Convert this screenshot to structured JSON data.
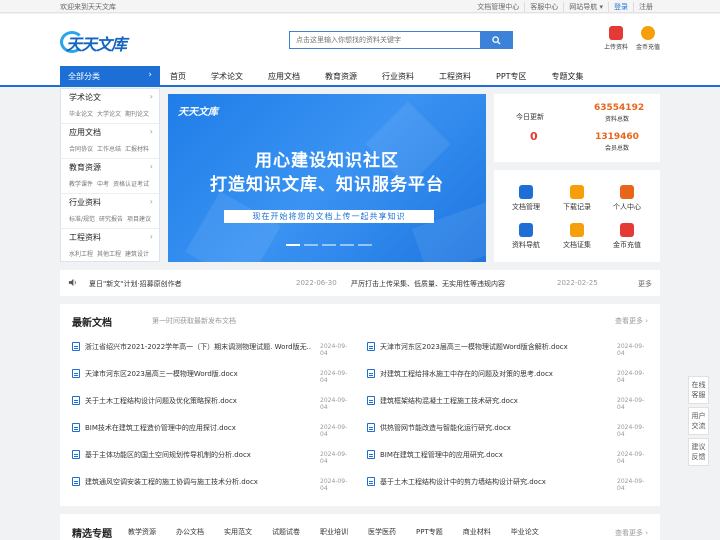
{
  "topbar": {
    "welcome": "欢迎来到天天文库",
    "links": [
      "文档管理中心",
      "客服中心",
      "网站导航 ▾",
      "登录",
      "注册"
    ]
  },
  "logo": {
    "text": "天天文库"
  },
  "search": {
    "placeholder": "点击这里输入你想找的资料关键字"
  },
  "header_icons": [
    {
      "label": "上传资料",
      "icon": "upload-icon",
      "color": "#e53935"
    },
    {
      "label": "金币充值",
      "icon": "coin-icon",
      "color": "#f59f0b"
    }
  ],
  "nav": {
    "all_label": "全部分类",
    "items": [
      "首页",
      "学术论文",
      "应用文档",
      "教育资源",
      "行业资料",
      "工程资料",
      "PPT专区",
      "专题文集"
    ]
  },
  "categories": [
    {
      "title": "学术论文",
      "subs": [
        "毕业论文",
        "大学论文",
        "期刊论文"
      ]
    },
    {
      "title": "应用文档",
      "subs": [
        "合同协议",
        "工作总结",
        "汇报材料"
      ]
    },
    {
      "title": "教育资源",
      "subs": [
        "教学课件",
        "中考",
        "资格认证考试"
      ]
    },
    {
      "title": "行业资料",
      "subs": [
        "标准/规范",
        "研究报告",
        "项目建议"
      ]
    },
    {
      "title": "工程资料",
      "subs": [
        "水利工程",
        "其他工程",
        "建筑设计"
      ]
    }
  ],
  "banner": {
    "brand": "天天文库",
    "line1": "用心建设知识社区",
    "line2": "打造知识文库、知识服务平台",
    "pill": "现在开始将您的文档上传一起共享知识"
  },
  "stats": {
    "today_label": "今日更新",
    "today_value": "0",
    "total_docs_value": "63554192",
    "total_docs_label": "资料总数",
    "members_value": "1319460",
    "members_label": "会员总数"
  },
  "quick_links": [
    {
      "label": "文档管理",
      "icon": "doc-manage-icon",
      "color": "#1d6fd6"
    },
    {
      "label": "下载记录",
      "icon": "download-icon",
      "color": "#f59f0b"
    },
    {
      "label": "个人中心",
      "icon": "user-icon",
      "color": "#e8651c"
    },
    {
      "label": "资料导航",
      "icon": "nav-icon",
      "color": "#1d6fd6"
    },
    {
      "label": "文档证集",
      "icon": "collect-icon",
      "color": "#f59f0b"
    },
    {
      "label": "金币充值",
      "icon": "coin-icon",
      "color": "#e53935"
    }
  ],
  "notice": {
    "item1": "夏日\"新文\"计划·招募原创作者",
    "date1": "2022-06-30",
    "item2": "严厉打击上传采集、低质量、无实用性等违规内容",
    "date2": "2022-02-25",
    "more": "更多"
  },
  "newest": {
    "title": "最新文档",
    "subtitle": "第一时间获取最新发布文档",
    "more": "查看更多 ›",
    "docs": [
      {
        "name": "浙江省绍兴市2021-2022学年高一（下）期末调测物理试题. Word版无...",
        "date": "2024-09-04"
      },
      {
        "name": "天津市河东区2023届高三一模物理试题Word版含解析.docx",
        "date": "2024-09-04"
      },
      {
        "name": "天津市河东区2023届高三一模物理Word版.docx",
        "date": "2024-09-04"
      },
      {
        "name": "对建筑工程给排水施工中存在的问题及对策的思考.docx",
        "date": "2024-09-04"
      },
      {
        "name": "关于土木工程结构设计问题及优化策略探析.docx",
        "date": "2024-09-04"
      },
      {
        "name": "建筑框架结构混凝土工程施工技术研究.docx",
        "date": "2024-09-04"
      },
      {
        "name": "BIM技术在建筑工程造价管理中的应用探讨.docx",
        "date": "2024-09-04"
      },
      {
        "name": "供热管网节能改造与智能化运行研究.docx",
        "date": "2024-09-04"
      },
      {
        "name": "基于主体功能区的国土空间规划传导机制的分析.docx",
        "date": "2024-09-04"
      },
      {
        "name": "BIM在建筑工程管理中的应用研究.docx",
        "date": "2024-09-04"
      },
      {
        "name": "建筑通风空调安装工程的施工协调与施工技术分析.docx",
        "date": "2024-09-04"
      },
      {
        "name": "基于土木工程结构设计中的剪力墙结构设计研究.docx",
        "date": "2024-09-04"
      }
    ]
  },
  "topics": {
    "title": "精选专题",
    "items": [
      "教学资源",
      "办公文档",
      "实用范文",
      "试题试卷",
      "职业培训",
      "医学医药",
      "PPT专题",
      "商业材料",
      "毕业论文"
    ],
    "more": "查看更多 ›"
  },
  "float_buttons": [
    {
      "line1": "在线",
      "line2": "客服"
    },
    {
      "line1": "用户",
      "line2": "交流"
    },
    {
      "line1": "建议",
      "line2": "反馈"
    }
  ]
}
